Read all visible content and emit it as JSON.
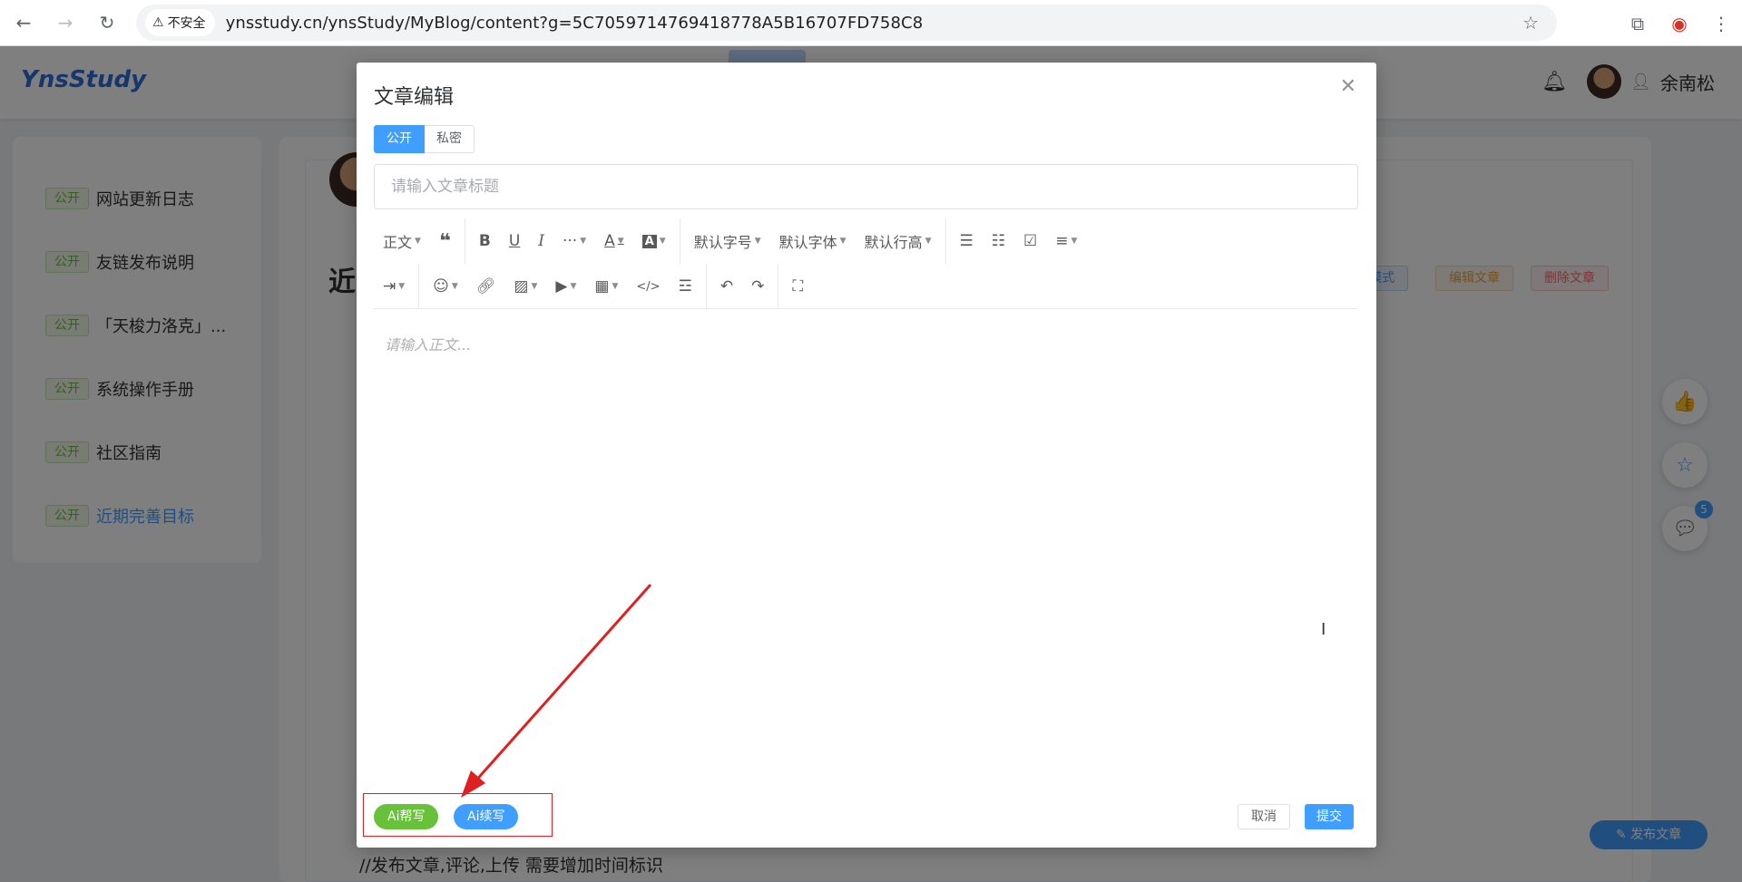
{
  "browser": {
    "security_label": "不安全",
    "url": "ynsstudy.cn/ynsStudy/MyBlog/content?g=5C7059714769418778A5B16707FD758C8",
    "icons": [
      "back-arrow-icon",
      "forward-arrow-icon",
      "reload-icon",
      "warning-icon",
      "bookmark-star-icon",
      "extensions-icon",
      "profile-icon",
      "kebab-menu-icon"
    ]
  },
  "site": {
    "logo": "YnsStudy",
    "username": "余南松"
  },
  "sidebar": {
    "items": [
      {
        "tag": "公开",
        "label": "网站更新日志"
      },
      {
        "tag": "公开",
        "label": "友链发布说明"
      },
      {
        "tag": "公开",
        "label": "「天梭力洛克」..."
      },
      {
        "tag": "公开",
        "label": "系统操作手册"
      },
      {
        "tag": "公开",
        "label": "社区指南"
      },
      {
        "tag": "公开",
        "label": "近期完善目标"
      }
    ]
  },
  "post": {
    "title_fragment": "近",
    "actions": {
      "mode": "模式",
      "edit": "编辑文章",
      "delete": "删除文章"
    },
    "body_line": "//发布文章,评论,上传  需要增加时间标识",
    "comment_count": "5",
    "publish_button": "发布文章"
  },
  "dialog": {
    "title": "文章编辑",
    "visibility": {
      "public": "公开",
      "private": "私密"
    },
    "title_placeholder": "请输入文章标题",
    "toolbar": {
      "paragraph": "正文",
      "font_size": "默认字号",
      "font_family": "默认字体",
      "line_height": "默认行高"
    },
    "editor_placeholder": "请输入正文...",
    "ai_help": "Ai帮写",
    "ai_continue": "Ai续写",
    "cancel": "取消",
    "submit": "提交"
  },
  "colors": {
    "primary": "#409eff",
    "success": "#67c23a",
    "warning": "#e6a23c",
    "danger": "#f56c6c",
    "annotation_red": "#e02020"
  }
}
